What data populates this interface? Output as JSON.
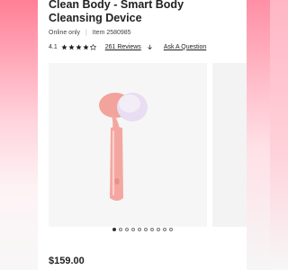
{
  "product": {
    "title": "Clean Body - Smart Body Cleansing Device",
    "availability": "Online only",
    "item_number": "Item 2580985",
    "rating": "4.1",
    "rating_stars": 4,
    "reviews_label": "261 Reviews",
    "ask_label": "Ask A Question",
    "price": "$159.00"
  },
  "carousel": {
    "dot_count": 10,
    "active_index": 0
  },
  "colors": {
    "device_pink": "#f4a7a0",
    "bristles": "#e6d8f0"
  },
  "icons": {
    "star": "star-icon",
    "chevron": "chevron-down-icon"
  }
}
